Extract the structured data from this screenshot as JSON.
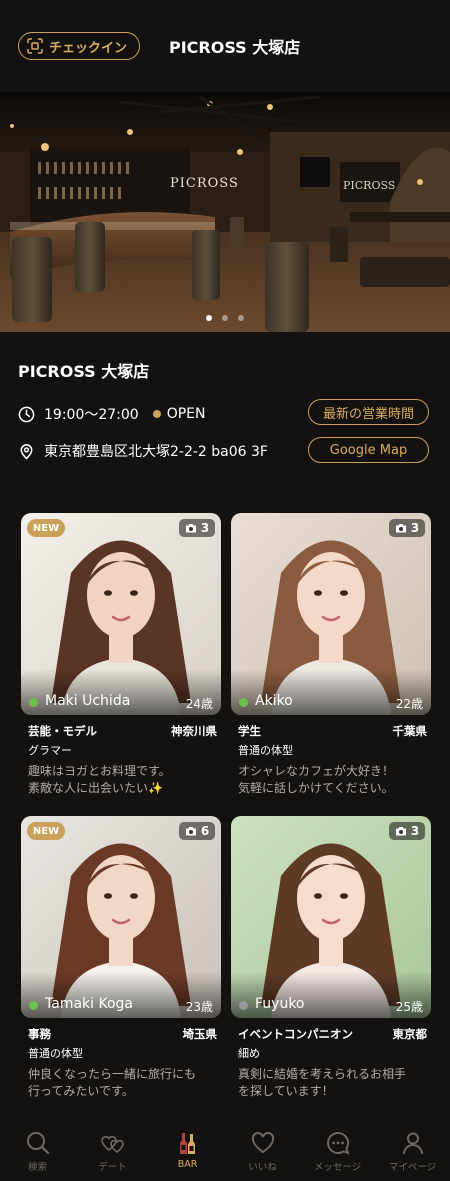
{
  "header": {
    "checkin_label": "チェックイン",
    "title": "PICROSS 大塚店"
  },
  "hero": {
    "signage_main": "PICROSS",
    "signage_side": "PICROSS",
    "carousel_count": 3,
    "carousel_active": 1
  },
  "store": {
    "name": "PICROSS 大塚店",
    "hours": "19:00〜27:00",
    "status": "OPEN",
    "address": "東京都豊島区北大塚2-2-2 ba06 3F",
    "hours_button": "最新の営業時間",
    "map_button": "Google Map"
  },
  "cards": [
    {
      "is_new": true,
      "new_label": "NEW",
      "photo_count": "3",
      "online": true,
      "name": "Maki Uchida",
      "age": "24歳",
      "job": "芸能・モデル",
      "prefecture": "神奈川県",
      "body_type": "グラマー",
      "message": "趣味はヨガとお料理です。\n素敵な人に出会いたい✨"
    },
    {
      "is_new": false,
      "new_label": "",
      "photo_count": "3",
      "online": true,
      "name": "Akiko",
      "age": "22歳",
      "job": "学生",
      "prefecture": "千葉県",
      "body_type": "普通の体型",
      "message": "オシャレなカフェが大好き！\n気軽に話しかけてください。"
    },
    {
      "is_new": true,
      "new_label": "NEW",
      "photo_count": "6",
      "online": true,
      "name": "Tamaki Koga",
      "age": "23歳",
      "job": "事務",
      "prefecture": "埼玉県",
      "body_type": "普通の体型",
      "message": "仲良くなったら一緒に旅行にも\n行ってみたいです。"
    },
    {
      "is_new": false,
      "new_label": "",
      "photo_count": "3",
      "online": false,
      "name": "Fuyuko",
      "age": "25歳",
      "job": "イベントコンパニオン",
      "prefecture": "東京都",
      "body_type": "細め",
      "message": "真剣に結婚を考えられるお相手\nを探しています！"
    }
  ],
  "tabs": [
    {
      "label": "検索",
      "icon": "search-icon"
    },
    {
      "label": "デート",
      "icon": "hearts-icon"
    },
    {
      "label": "BAR",
      "icon": "bar-bottles-icon",
      "active": true
    },
    {
      "label": "いいね",
      "icon": "heart-icon"
    },
    {
      "label": "メッセージ",
      "icon": "chat-icon"
    },
    {
      "label": "マイページ",
      "icon": "person-icon"
    }
  ],
  "colors": {
    "background": "#141210",
    "accent_gold": "#c9a15b",
    "online_green": "#6cc24a",
    "offline_gray": "#9a9a9a",
    "muted_text": "#b3aca3"
  }
}
